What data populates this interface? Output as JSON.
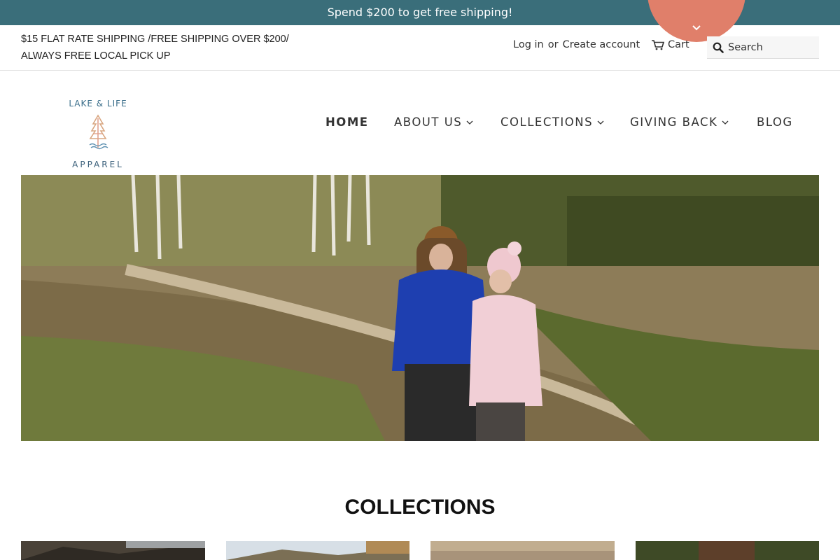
{
  "announcement": {
    "text": "Spend $200 to get free shipping!"
  },
  "topbar": {
    "shipping_line1": "$15 FLAT RATE SHIPPING /FREE SHIPPING OVER $200/",
    "shipping_line2": "ALWAYS FREE LOCAL PICK UP",
    "login": "Log in",
    "or": "or",
    "create_account": "Create account",
    "cart": "Cart",
    "search_placeholder": "Search"
  },
  "logo": {
    "top_text": "LAKE & LIFE",
    "bottom_text": "APPAREL"
  },
  "nav": {
    "items": [
      {
        "label": "HOME",
        "active": true,
        "dropdown": false
      },
      {
        "label": "ABOUT US",
        "active": false,
        "dropdown": true
      },
      {
        "label": "COLLECTIONS",
        "active": false,
        "dropdown": true
      },
      {
        "label": "GIVING BACK",
        "active": false,
        "dropdown": true
      },
      {
        "label": "BLOG",
        "active": false,
        "dropdown": false
      }
    ]
  },
  "collections": {
    "title": "COLLECTIONS"
  },
  "colors": {
    "announcement_bg": "#3a6e7a",
    "accent_coral": "#e07f6a",
    "logo_blue": "#3a6e8a"
  },
  "icons": [
    "cart-icon",
    "search-icon",
    "chevron-down-icon",
    "tree-logo-icon"
  ]
}
